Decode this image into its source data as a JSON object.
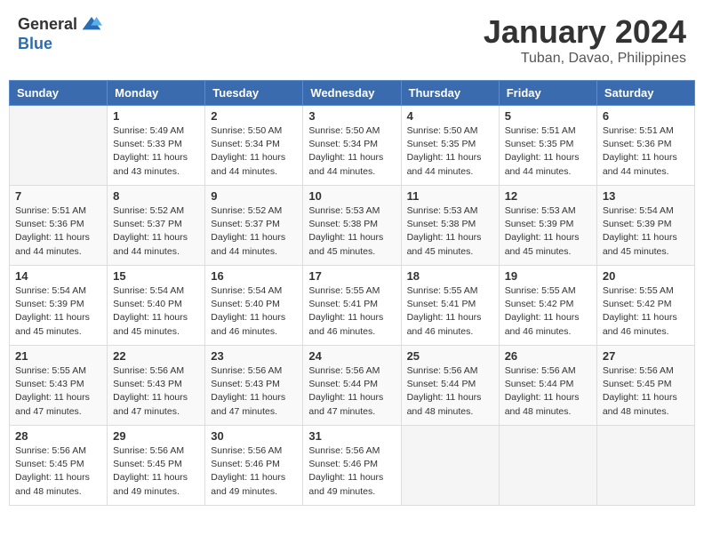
{
  "header": {
    "logo_general": "General",
    "logo_blue": "Blue",
    "month_title": "January 2024",
    "location": "Tuban, Davao, Philippines"
  },
  "days_of_week": [
    "Sunday",
    "Monday",
    "Tuesday",
    "Wednesday",
    "Thursday",
    "Friday",
    "Saturday"
  ],
  "weeks": [
    [
      {
        "day": "",
        "info": ""
      },
      {
        "day": "1",
        "info": "Sunrise: 5:49 AM\nSunset: 5:33 PM\nDaylight: 11 hours\nand 43 minutes."
      },
      {
        "day": "2",
        "info": "Sunrise: 5:50 AM\nSunset: 5:34 PM\nDaylight: 11 hours\nand 44 minutes."
      },
      {
        "day": "3",
        "info": "Sunrise: 5:50 AM\nSunset: 5:34 PM\nDaylight: 11 hours\nand 44 minutes."
      },
      {
        "day": "4",
        "info": "Sunrise: 5:50 AM\nSunset: 5:35 PM\nDaylight: 11 hours\nand 44 minutes."
      },
      {
        "day": "5",
        "info": "Sunrise: 5:51 AM\nSunset: 5:35 PM\nDaylight: 11 hours\nand 44 minutes."
      },
      {
        "day": "6",
        "info": "Sunrise: 5:51 AM\nSunset: 5:36 PM\nDaylight: 11 hours\nand 44 minutes."
      }
    ],
    [
      {
        "day": "7",
        "info": "Sunrise: 5:51 AM\nSunset: 5:36 PM\nDaylight: 11 hours\nand 44 minutes."
      },
      {
        "day": "8",
        "info": "Sunrise: 5:52 AM\nSunset: 5:37 PM\nDaylight: 11 hours\nand 44 minutes."
      },
      {
        "day": "9",
        "info": "Sunrise: 5:52 AM\nSunset: 5:37 PM\nDaylight: 11 hours\nand 44 minutes."
      },
      {
        "day": "10",
        "info": "Sunrise: 5:53 AM\nSunset: 5:38 PM\nDaylight: 11 hours\nand 45 minutes."
      },
      {
        "day": "11",
        "info": "Sunrise: 5:53 AM\nSunset: 5:38 PM\nDaylight: 11 hours\nand 45 minutes."
      },
      {
        "day": "12",
        "info": "Sunrise: 5:53 AM\nSunset: 5:39 PM\nDaylight: 11 hours\nand 45 minutes."
      },
      {
        "day": "13",
        "info": "Sunrise: 5:54 AM\nSunset: 5:39 PM\nDaylight: 11 hours\nand 45 minutes."
      }
    ],
    [
      {
        "day": "14",
        "info": "Sunrise: 5:54 AM\nSunset: 5:39 PM\nDaylight: 11 hours\nand 45 minutes."
      },
      {
        "day": "15",
        "info": "Sunrise: 5:54 AM\nSunset: 5:40 PM\nDaylight: 11 hours\nand 45 minutes."
      },
      {
        "day": "16",
        "info": "Sunrise: 5:54 AM\nSunset: 5:40 PM\nDaylight: 11 hours\nand 46 minutes."
      },
      {
        "day": "17",
        "info": "Sunrise: 5:55 AM\nSunset: 5:41 PM\nDaylight: 11 hours\nand 46 minutes."
      },
      {
        "day": "18",
        "info": "Sunrise: 5:55 AM\nSunset: 5:41 PM\nDaylight: 11 hours\nand 46 minutes."
      },
      {
        "day": "19",
        "info": "Sunrise: 5:55 AM\nSunset: 5:42 PM\nDaylight: 11 hours\nand 46 minutes."
      },
      {
        "day": "20",
        "info": "Sunrise: 5:55 AM\nSunset: 5:42 PM\nDaylight: 11 hours\nand 46 minutes."
      }
    ],
    [
      {
        "day": "21",
        "info": "Sunrise: 5:55 AM\nSunset: 5:43 PM\nDaylight: 11 hours\nand 47 minutes."
      },
      {
        "day": "22",
        "info": "Sunrise: 5:56 AM\nSunset: 5:43 PM\nDaylight: 11 hours\nand 47 minutes."
      },
      {
        "day": "23",
        "info": "Sunrise: 5:56 AM\nSunset: 5:43 PM\nDaylight: 11 hours\nand 47 minutes."
      },
      {
        "day": "24",
        "info": "Sunrise: 5:56 AM\nSunset: 5:44 PM\nDaylight: 11 hours\nand 47 minutes."
      },
      {
        "day": "25",
        "info": "Sunrise: 5:56 AM\nSunset: 5:44 PM\nDaylight: 11 hours\nand 48 minutes."
      },
      {
        "day": "26",
        "info": "Sunrise: 5:56 AM\nSunset: 5:44 PM\nDaylight: 11 hours\nand 48 minutes."
      },
      {
        "day": "27",
        "info": "Sunrise: 5:56 AM\nSunset: 5:45 PM\nDaylight: 11 hours\nand 48 minutes."
      }
    ],
    [
      {
        "day": "28",
        "info": "Sunrise: 5:56 AM\nSunset: 5:45 PM\nDaylight: 11 hours\nand 48 minutes."
      },
      {
        "day": "29",
        "info": "Sunrise: 5:56 AM\nSunset: 5:45 PM\nDaylight: 11 hours\nand 49 minutes."
      },
      {
        "day": "30",
        "info": "Sunrise: 5:56 AM\nSunset: 5:46 PM\nDaylight: 11 hours\nand 49 minutes."
      },
      {
        "day": "31",
        "info": "Sunrise: 5:56 AM\nSunset: 5:46 PM\nDaylight: 11 hours\nand 49 minutes."
      },
      {
        "day": "",
        "info": ""
      },
      {
        "day": "",
        "info": ""
      },
      {
        "day": "",
        "info": ""
      }
    ]
  ]
}
